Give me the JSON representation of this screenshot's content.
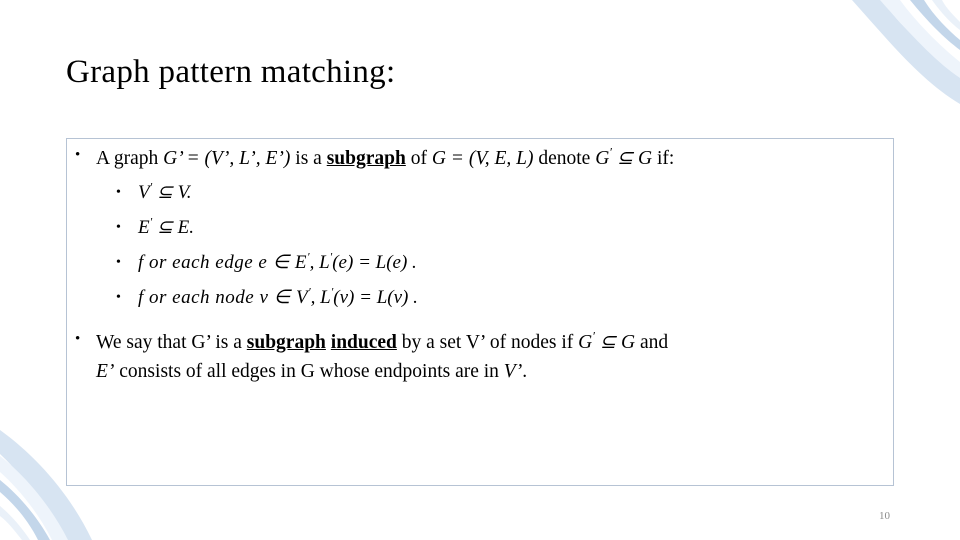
{
  "slide": {
    "title": "Graph pattern matching:",
    "page_number": "10",
    "accent_color": "#b6c3d4",
    "decor_color": "#c9d9ec",
    "bullets": [
      {
        "level": 1,
        "marker": "•",
        "segments": [
          {
            "text": "A graph ",
            "style": "normal"
          },
          {
            "text": "G’ = (V’, L’, E’)",
            "style": "italic"
          },
          {
            "text": " is a ",
            "style": "normal"
          },
          {
            "text": "subgraph",
            "style": "bold-underline"
          },
          {
            "text": " of ",
            "style": "normal"
          },
          {
            "text": "G = (V, E, L)",
            "style": "italic"
          },
          {
            "text": " denote ",
            "style": "normal"
          },
          {
            "text": "G′ ⊆ G",
            "style": "italic"
          },
          {
            "text": " if:",
            "style": "normal"
          }
        ]
      },
      {
        "level": 2,
        "marker": "•",
        "segments": [
          {
            "text": "V′ ⊆ V.",
            "style": "italic"
          }
        ]
      },
      {
        "level": 2,
        "marker": "•",
        "segments": [
          {
            "text": "E′ ⊆ E.",
            "style": "italic"
          }
        ]
      },
      {
        "level": 2,
        "marker": "•",
        "segments": [
          {
            "text": "for each edge e ∈ E′,  L′(e) = L(e) .",
            "style": "italic"
          }
        ]
      },
      {
        "level": 2,
        "marker": "•",
        "segments": [
          {
            "text": "for each node v ∈ V′,  L′(v) = L(v) .",
            "style": "italic"
          }
        ]
      },
      {
        "level": 1,
        "marker": "•",
        "segments": [
          {
            "text": "We say that G’ is a ",
            "style": "normal"
          },
          {
            "text": "subgraph",
            "style": "bold-underline"
          },
          {
            "text": " ",
            "style": "normal"
          },
          {
            "text": "induced",
            "style": "bold-underline"
          },
          {
            "text": " by a set V’ of nodes if ",
            "style": "normal"
          },
          {
            "text": "G′ ⊆ G",
            "style": "italic"
          },
          {
            "text": " and ",
            "style": "normal"
          },
          {
            "text": "E’",
            "style": "italic"
          },
          {
            "text": " consists of all edges in G whose endpoints are in ",
            "style": "normal"
          },
          {
            "text": "V’",
            "style": "italic"
          },
          {
            "text": ".",
            "style": "normal"
          }
        ]
      }
    ],
    "lines": {
      "l1_a": "A graph ",
      "l1_b": "G’ = (V’, L’, E’)",
      "l1_c": " is a ",
      "l1_d": "subgraph",
      "l1_e": " of ",
      "l1_f": "G = (V, E, L)",
      "l1_g": " denote ",
      "l1_h": "G",
      "l1_i": " ⊆ G",
      "l1_j": " if:",
      "l2_1a": "V",
      "l2_1b": " ⊆ V.",
      "l2_2a": "E",
      "l2_2b": " ⊆ E.",
      "l2_3a": "f or each edge e ∈ E",
      "l2_3b": ",  L",
      "l2_3c": "(e) = L(e) .",
      "l2_4a": "f or each node v ∈ V",
      "l2_4b": ",  L",
      "l2_4c": "(v) = L(v) .",
      "l3_a": "We say that G’ is a ",
      "l3_b": "subgraph",
      "l3_c": "induced",
      "l3_d": " by a set V’ of nodes if ",
      "l3_e": "G",
      "l3_f": " ⊆ G",
      "l3_g": " and",
      "l3_h": "E’",
      "l3_i": " consists of all edges in G whose endpoints are in ",
      "l3_j": "V’",
      "l3_k": "."
    }
  }
}
